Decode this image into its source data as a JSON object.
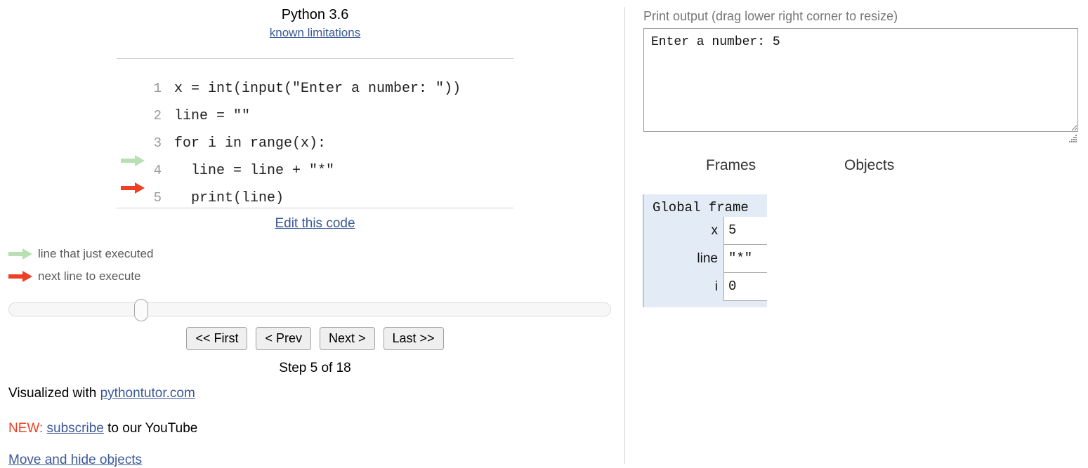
{
  "code_panel": {
    "language_title": "Python 3.6",
    "known_limitations_link": "known limitations",
    "edit_code_link": "Edit this code",
    "lines": [
      {
        "number": "1",
        "text": "x = int(input(\"Enter a number: \"))",
        "arrow": "none"
      },
      {
        "number": "2",
        "text": "line = \"\"",
        "arrow": "none"
      },
      {
        "number": "3",
        "text": "for i in range(x):",
        "arrow": "none"
      },
      {
        "number": "4",
        "text": "  line = line + \"*\"",
        "arrow": "green"
      },
      {
        "number": "5",
        "text": "  print(line)",
        "arrow": "red"
      }
    ]
  },
  "legend": {
    "executed": "line that just executed",
    "next": "next line to execute"
  },
  "slider": {
    "position_percent": 22
  },
  "navigation": {
    "first": "<< First",
    "prev": "< Prev",
    "next": "Next >",
    "last": "Last >>",
    "step_label": "Step 5 of 18",
    "current_step": 5,
    "total_steps": 18
  },
  "footer": {
    "credit_prefix": "Visualized with ",
    "credit_link": "pythontutor.com",
    "promo_tag": "NEW:",
    "promo_link": "subscribe",
    "promo_suffix": " to our YouTube",
    "move_hide_link": "Move and hide objects"
  },
  "output_panel": {
    "print_output_label": "Print output (drag lower right corner to resize)",
    "print_output_text": "Enter a number: 5",
    "frames_header": "Frames",
    "objects_header": "Objects"
  },
  "global_frame": {
    "title": "Global frame",
    "variables": [
      {
        "name": "x",
        "value": "5"
      },
      {
        "name": "line",
        "value": "\"*\""
      },
      {
        "name": "i",
        "value": "0"
      }
    ]
  },
  "colors": {
    "link": "#3b5998",
    "next_arrow": "#ef4026",
    "executed_arrow": "#b8e0b3",
    "frame_bg": "#e2ebf6",
    "new_tag": "#ef4026"
  }
}
